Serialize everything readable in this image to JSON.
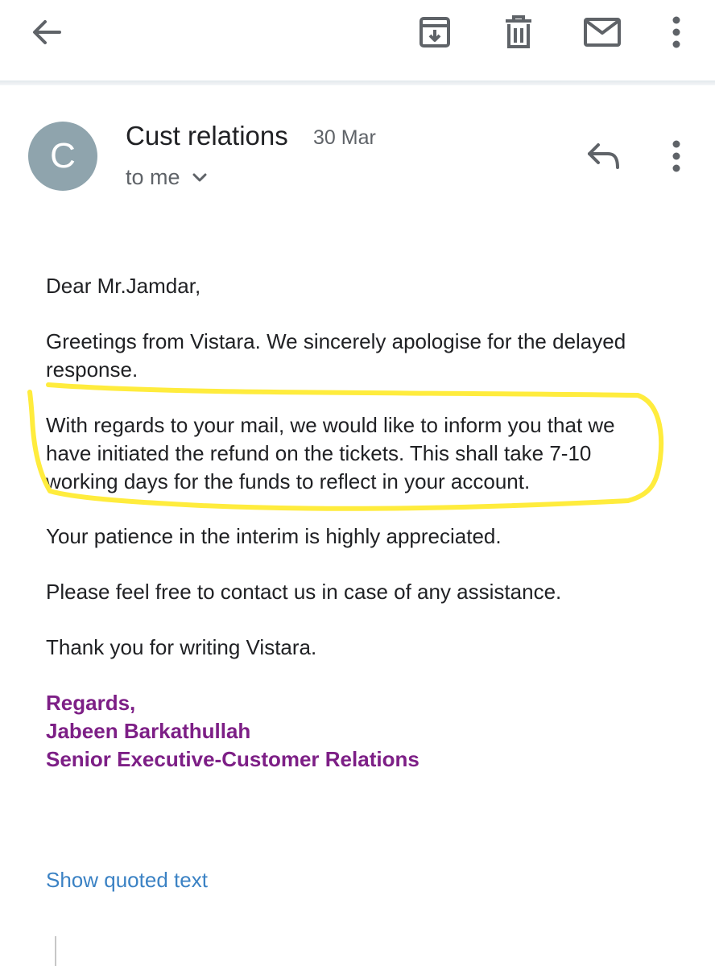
{
  "toolbar": {
    "icons": [
      "back-arrow-icon",
      "archive-icon",
      "delete-icon",
      "mark-unread-icon",
      "more-vert-icon"
    ]
  },
  "message": {
    "avatar_letter": "C",
    "sender": "Cust relations",
    "date": "30 Mar",
    "recipient": "to me",
    "body": {
      "greeting": "Dear Mr.Jamdar,",
      "p1_line1": "Greetings from Vistara. We sincerely apologise for the delayed",
      "p1_line2": "response.",
      "p2_line1": "With regards to your mail, we would like to inform you that we",
      "p2_line2": "have initiated the refund on the tickets. This shall take 7-10",
      "p2_line3": "working days for the funds to reflect in your account.",
      "p3": "Your patience in the interim is highly appreciated.",
      "p4": "Please feel free to contact us in case of any assistance.",
      "p5": "Thank you for writing Vistara."
    },
    "signature": {
      "line1": "Regards,",
      "line2": "Jabeen Barkathullah",
      "line3": "Senior Executive-Customer Relations"
    },
    "show_quoted_label": "Show quoted text"
  },
  "colors": {
    "avatar": "#8fa4ad",
    "signature": "#7d1f86",
    "link": "#3b82c4",
    "highlight": "#ffec3d"
  }
}
